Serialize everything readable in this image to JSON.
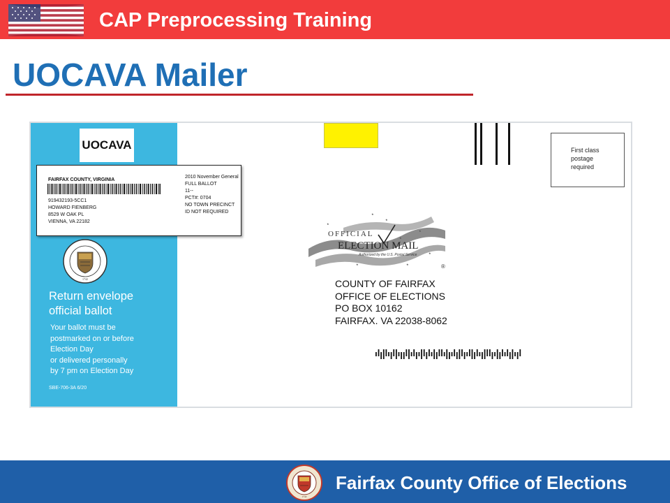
{
  "header": {
    "title": "CAP Preprocessing Training",
    "bar_color": "#f23c3c",
    "flag_icon": "us-flag-icon"
  },
  "slide": {
    "title": "UOCAVA Mailer",
    "title_color": "#1f6fb5",
    "rule_color": "#c0252b"
  },
  "envelope": {
    "flap_color": "#3db7e0",
    "tag": "UOCAVA",
    "address_label": {
      "county": "FAIRFAX COUNTY, VIRGINIA",
      "voter_lines": [
        "919432193-5CC1",
        "HOWARD FIENBERG",
        "8529 W OAK PL",
        "VIENNA, VA  22182"
      ],
      "ballot_lines": [
        "2010 November General",
        "FULL BALLOT",
        "11--",
        "PCT#: 0704",
        "NO TOWN PRECINCT",
        "ID NOT REQUIRED"
      ]
    },
    "seal_icon": "fairfax-county-seal-icon",
    "return_heading": [
      "Return envelope",
      "official ballot"
    ],
    "return_body": [
      "Your ballot must be",
      "postmarked  on or before",
      "Election Day",
      "or delivered personally",
      "by 7 pm on Election Day"
    ],
    "form_code": "SBE-706-3A 6/20",
    "postage": [
      "First class",
      "postage",
      "required"
    ],
    "emblem": {
      "line1": "OFFICIAL",
      "line2": "ELECTION MAIL",
      "tagline": "Authorized by the U.S. Postal Service",
      "mark": "®"
    },
    "recipient": [
      "COUNTY OF FAIRFAX",
      "OFFICE OF ELECTIONS",
      "PO BOX 10162",
      "FAIRFAX. VA 22038-8062"
    ],
    "highlight_color": "#fff200"
  },
  "footer": {
    "text": "Fairfax County Office of Elections",
    "bar_color": "#1f5fa8",
    "seal_icon": "fairfax-county-seal-icon"
  }
}
